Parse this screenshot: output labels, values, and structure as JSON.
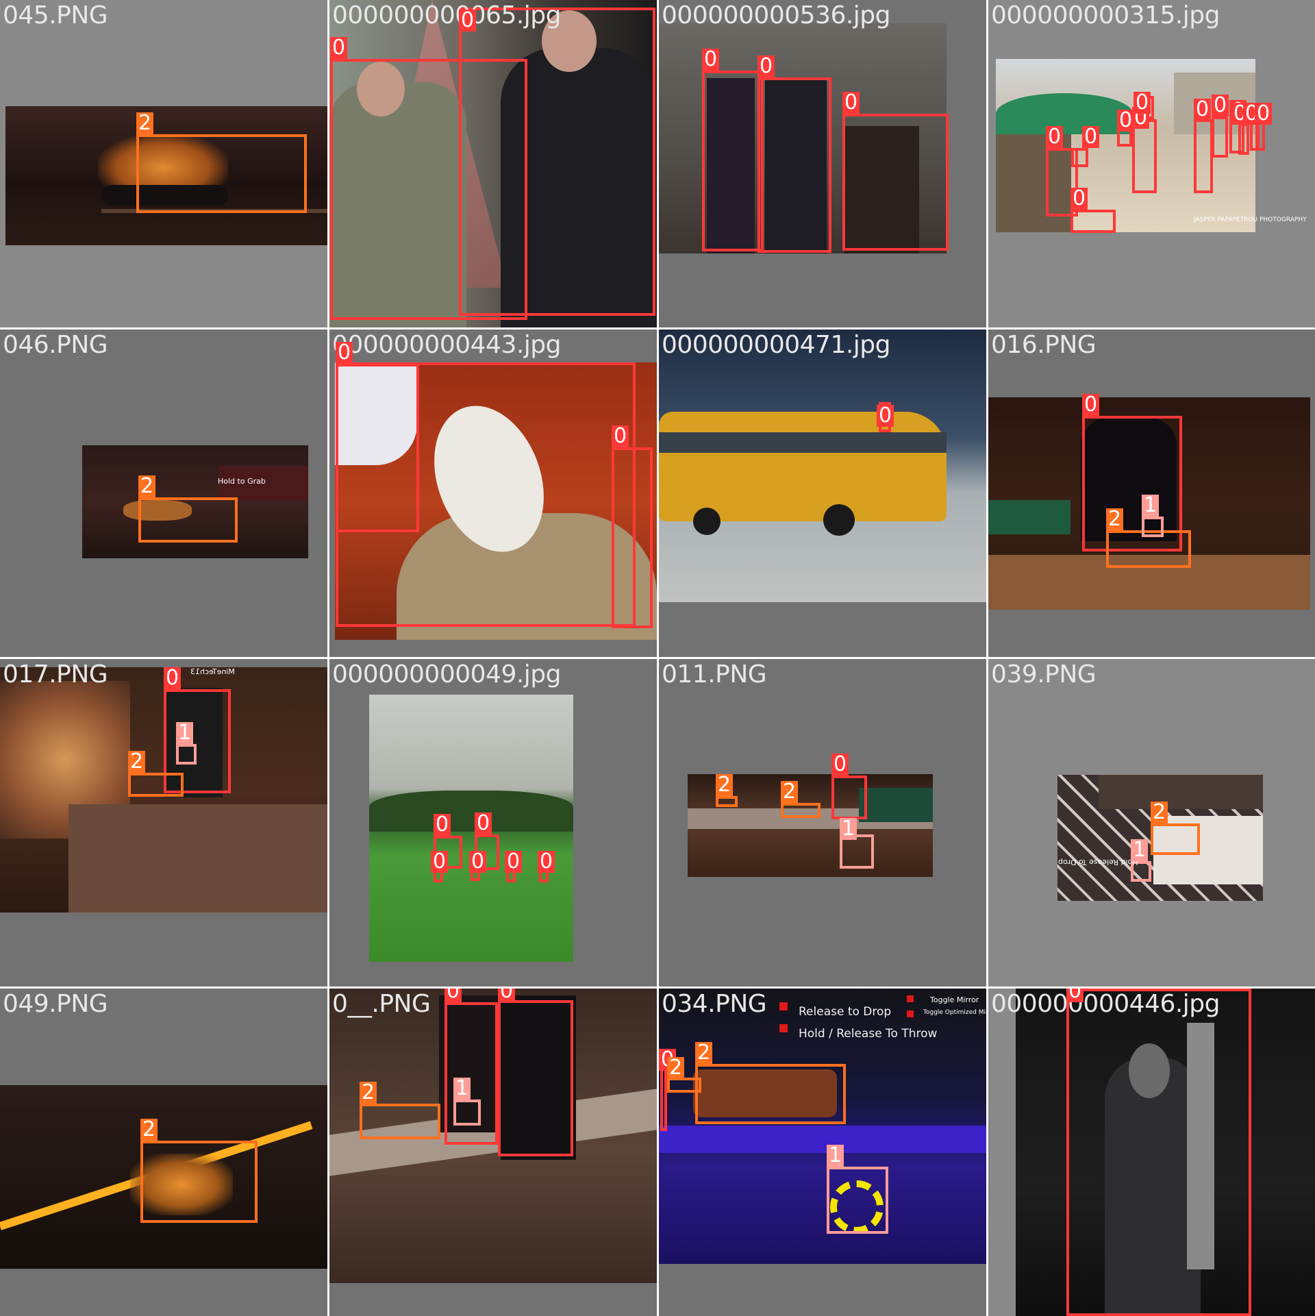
{
  "grid": {
    "tiles": [
      {
        "filename": "045.PNG",
        "labels": [
          "2"
        ]
      },
      {
        "filename": "000000000065.jpg",
        "labels": [
          "0",
          "0"
        ]
      },
      {
        "filename": "000000000536.jpg",
        "labels": [
          "0",
          "0",
          "0"
        ]
      },
      {
        "filename": "000000000315.jpg",
        "labels": [
          "0",
          "0",
          "0",
          "0",
          "0",
          "0",
          "0",
          "0",
          "0",
          "0",
          "0",
          "0"
        ],
        "watermark": "JASPER PAPAPETROU PHOTOGRAPHY"
      },
      {
        "filename": "046.PNG",
        "labels": [
          "2"
        ],
        "ui_hint": "Hold to Grab"
      },
      {
        "filename": "000000000443.jpg",
        "labels": [
          "0",
          "0"
        ]
      },
      {
        "filename": "000000000471.jpg",
        "labels": [
          "0"
        ]
      },
      {
        "filename": "016.PNG",
        "labels": [
          "0",
          "2",
          "1"
        ]
      },
      {
        "filename": "017.PNG",
        "labels": [
          "0",
          "1",
          "2"
        ],
        "sign": "MineTech13"
      },
      {
        "filename": "000000000049.jpg",
        "labels": [
          "0",
          "0",
          "0",
          "0",
          "0",
          "0"
        ]
      },
      {
        "filename": "011.PNG",
        "labels": [
          "2",
          "2",
          "0",
          "1"
        ]
      },
      {
        "filename": "039.PNG",
        "labels": [
          "2",
          "1"
        ],
        "ui_hint": "Hold Release To Drop"
      },
      {
        "filename": "049.PNG",
        "labels": [
          "2"
        ]
      },
      {
        "filename": "0__.PNG",
        "labels": [
          "0",
          "0",
          "2",
          "1"
        ]
      },
      {
        "filename": "034.PNG",
        "labels": [
          "0",
          "2",
          "2",
          "1"
        ],
        "ui": {
          "release": "Release to Drop",
          "hold": "Hold / Release To Throw",
          "toggle_mirror": "Toggle Mirror",
          "toggle_optimized": "Toggle Optimized Mirror"
        }
      },
      {
        "filename": "000000000446.jpg",
        "labels": [
          "0"
        ]
      }
    ]
  },
  "classes": {
    "0": "#ff3838",
    "1": "#ff9d97",
    "2": "#ff701f"
  }
}
